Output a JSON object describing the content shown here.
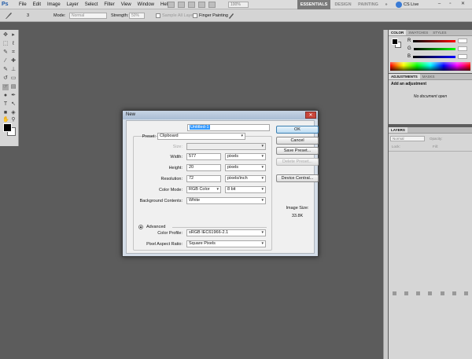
{
  "app": {
    "logo": "Ps"
  },
  "menu": [
    "File",
    "Edit",
    "Image",
    "Layer",
    "Select",
    "Filter",
    "View",
    "Window",
    "Help"
  ],
  "zoom": "100%",
  "workspaces": {
    "essentials": "ESSENTIALS",
    "design": "DESIGN",
    "painting": "PAINTING",
    "more": "»"
  },
  "cslive": "CS Live",
  "options": {
    "size": "3",
    "mode_label": "Mode:",
    "mode_value": "Normal",
    "strength_label": "Strength:",
    "strength_value": "50%",
    "sample_all_layers": "Sample All Layers",
    "finger_painting": "Finger Painting"
  },
  "color_panel": {
    "tabs": [
      "COLOR",
      "SWATCHES",
      "STYLES"
    ],
    "channels": [
      "R",
      "G",
      "B"
    ]
  },
  "adjustments_panel": {
    "tabs": [
      "ADJUSTMENTS",
      "MASKS"
    ],
    "title": "Add an adjustment",
    "message": "No document open"
  },
  "layers_panel": {
    "tabs": [
      "LAYERS"
    ],
    "blend_mode": "Normal",
    "opacity_label": "Opacity:",
    "lock_label": "Lock:",
    "fill_label": "Fill:"
  },
  "dialog": {
    "title": "New",
    "close": "✕",
    "name_label": "Name:",
    "name_value": "Untitled-1",
    "preset_label": "Preset:",
    "preset_value": "Clipboard",
    "size_label": "Size:",
    "width_label": "Width:",
    "width_value": "577",
    "width_unit": "pixels",
    "height_label": "Height:",
    "height_value": "20",
    "height_unit": "pixels",
    "resolution_label": "Resolution:",
    "resolution_value": "72",
    "resolution_unit": "pixels/inch",
    "color_mode_label": "Color Mode:",
    "color_mode_value": "RGB Color",
    "bit_depth": "8 bit",
    "background_label": "Background Contents:",
    "background_value": "White",
    "advanced_label": "Advanced",
    "color_profile_label": "Color Profile:",
    "color_profile_value": "sRGB IEC61966-2.1",
    "pixel_aspect_label": "Pixel Aspect Ratio:",
    "pixel_aspect_value": "Square Pixels",
    "ok": "OK",
    "cancel": "Cancel",
    "save_preset": "Save Preset...",
    "delete_preset": "Delete Preset...",
    "device_central": "Device Central...",
    "image_size_label": "Image Size:",
    "image_size_value": "33.8K"
  }
}
